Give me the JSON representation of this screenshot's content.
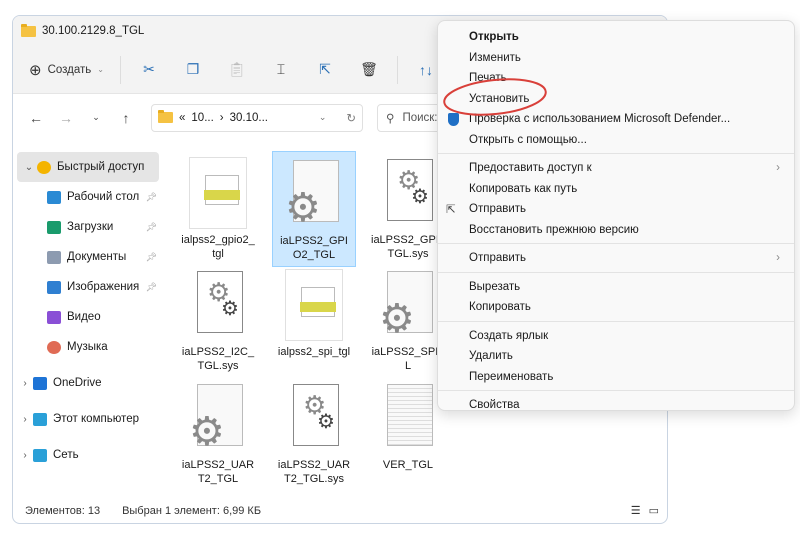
{
  "window": {
    "title": "30.100.2129.8_TGL"
  },
  "toolbar": {
    "new_label": "Создать",
    "sort_partial": "↑↓"
  },
  "address": {
    "path_prefix": "«",
    "seg1": "10...",
    "seg2": "30.10...",
    "search_placeholder": "Поиск:"
  },
  "sidebar": {
    "items": [
      {
        "label": "Быстрый доступ",
        "icon": "star-icon",
        "color": "#f4b400"
      },
      {
        "label": "Рабочий стол",
        "icon": "desktop-icon",
        "color": "#2a8ad4",
        "pinned": true
      },
      {
        "label": "Загрузки",
        "icon": "download-icon",
        "color": "#1a9b6c",
        "pinned": true
      },
      {
        "label": "Документы",
        "icon": "document-icon",
        "color": "#8d9bb0",
        "pinned": true
      },
      {
        "label": "Изображения",
        "icon": "pictures-icon",
        "color": "#2f7fd1",
        "pinned": true
      },
      {
        "label": "Видео",
        "icon": "video-icon",
        "color": "#8a4fd6"
      },
      {
        "label": "Музыка",
        "icon": "music-icon",
        "color": "#e06b55"
      },
      {
        "label": "OneDrive",
        "icon": "cloud-icon",
        "color": "#1e74d6"
      },
      {
        "label": "Этот компьютер",
        "icon": "computer-icon",
        "color": "#2aa0d8"
      },
      {
        "label": "Сеть",
        "icon": "network-icon",
        "color": "#2aa0d8"
      }
    ]
  },
  "files": [
    {
      "name": "ialpss2_gpio2_tgl",
      "type": "package"
    },
    {
      "name": "iaLPSS2_GPIO2_TGL",
      "type": "settings",
      "selected": true
    },
    {
      "name": "iaLPSS2_GPI_TGL.sys",
      "type": "system"
    },
    {
      "name": "iaLPSS2_I2C_TGL.sys",
      "type": "system"
    },
    {
      "name": "ialpss2_spi_tgl",
      "type": "package"
    },
    {
      "name": "iaLPSS2_SPI_L",
      "type": "settings"
    },
    {
      "name": "iaLPSS2_UART2_TGL",
      "type": "settings"
    },
    {
      "name": "iaLPSS2_UART2_TGL.sys",
      "type": "system"
    },
    {
      "name": "VER_TGL",
      "type": "text"
    }
  ],
  "status": {
    "count": "Элементов: 13",
    "selection": "Выбран 1 элемент: 6,99 КБ"
  },
  "context_menu": {
    "groups": [
      [
        {
          "label": "Открыть",
          "bold": true
        },
        {
          "label": "Изменить"
        },
        {
          "label": "Печать"
        },
        {
          "label": "Установить",
          "highlighted": true
        },
        {
          "label": "Проверка с использованием Microsoft Defender...",
          "icon": "shield-icon"
        },
        {
          "label": "Открыть с помощью..."
        }
      ],
      [
        {
          "label": "Предоставить доступ к",
          "submenu": true
        },
        {
          "label": "Копировать как путь"
        },
        {
          "label": "Отправить",
          "icon": "share-icon"
        },
        {
          "label": "Восстановить прежнюю версию"
        }
      ],
      [
        {
          "label": "Отправить",
          "submenu": true
        }
      ],
      [
        {
          "label": "Вырезать"
        },
        {
          "label": "Копировать"
        }
      ],
      [
        {
          "label": "Создать ярлык"
        },
        {
          "label": "Удалить"
        },
        {
          "label": "Переименовать"
        }
      ],
      [
        {
          "label": "Свойства"
        }
      ]
    ]
  },
  "annotation_color": "#d9403a"
}
